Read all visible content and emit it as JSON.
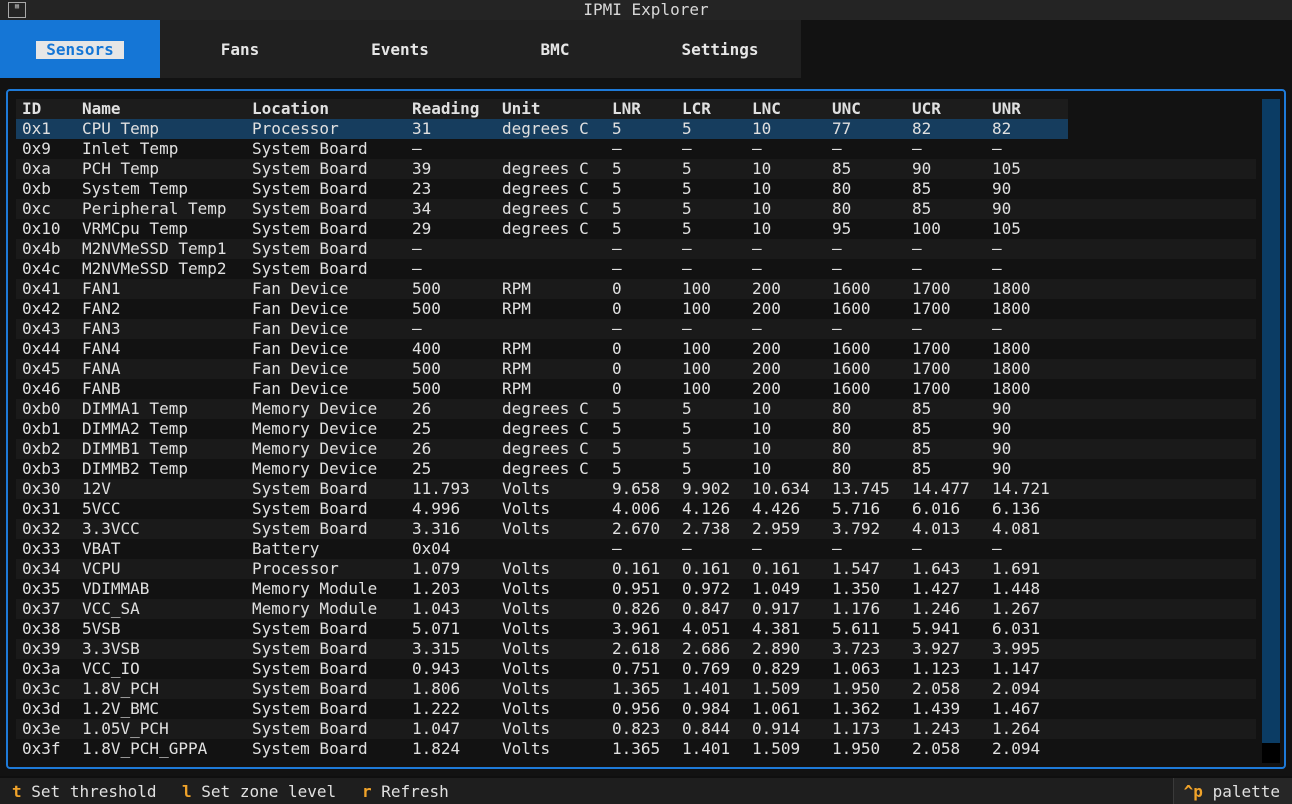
{
  "window": {
    "title": "IPMI Explorer",
    "corner_icon": "app-icon"
  },
  "tabs": [
    {
      "label": "Sensors",
      "active": true
    },
    {
      "label": "Fans",
      "active": false
    },
    {
      "label": "Events",
      "active": false
    },
    {
      "label": "BMC",
      "active": false
    },
    {
      "label": "Settings",
      "active": false
    }
  ],
  "table": {
    "columns": [
      "ID",
      "Name",
      "Location",
      "Reading",
      "Unit",
      "LNR",
      "LCR",
      "LNC",
      "UNC",
      "UCR",
      "UNR"
    ],
    "rows": [
      [
        "0x1",
        "CPU Temp",
        "Processor",
        "31",
        "degrees C",
        "5",
        "5",
        "10",
        "77",
        "82",
        "82"
      ],
      [
        "0x9",
        "Inlet Temp",
        "System Board",
        "–",
        "",
        "–",
        "–",
        "–",
        "–",
        "–",
        "–"
      ],
      [
        "0xa",
        "PCH Temp",
        "System Board",
        "39",
        "degrees C",
        "5",
        "5",
        "10",
        "85",
        "90",
        "105"
      ],
      [
        "0xb",
        "System Temp",
        "System Board",
        "23",
        "degrees C",
        "5",
        "5",
        "10",
        "80",
        "85",
        "90"
      ],
      [
        "0xc",
        "Peripheral Temp",
        "System Board",
        "34",
        "degrees C",
        "5",
        "5",
        "10",
        "80",
        "85",
        "90"
      ],
      [
        "0x10",
        "VRMCpu Temp",
        "System Board",
        "29",
        "degrees C",
        "5",
        "5",
        "10",
        "95",
        "100",
        "105"
      ],
      [
        "0x4b",
        "M2NVMeSSD Temp1",
        "System Board",
        "–",
        "",
        "–",
        "–",
        "–",
        "–",
        "–",
        "–"
      ],
      [
        "0x4c",
        "M2NVMeSSD Temp2",
        "System Board",
        "–",
        "",
        "–",
        "–",
        "–",
        "–",
        "–",
        "–"
      ],
      [
        "0x41",
        "FAN1",
        "Fan Device",
        "500",
        "RPM",
        "0",
        "100",
        "200",
        "1600",
        "1700",
        "1800"
      ],
      [
        "0x42",
        "FAN2",
        "Fan Device",
        "500",
        "RPM",
        "0",
        "100",
        "200",
        "1600",
        "1700",
        "1800"
      ],
      [
        "0x43",
        "FAN3",
        "Fan Device",
        "–",
        "",
        "–",
        "–",
        "–",
        "–",
        "–",
        "–"
      ],
      [
        "0x44",
        "FAN4",
        "Fan Device",
        "400",
        "RPM",
        "0",
        "100",
        "200",
        "1600",
        "1700",
        "1800"
      ],
      [
        "0x45",
        "FANA",
        "Fan Device",
        "500",
        "RPM",
        "0",
        "100",
        "200",
        "1600",
        "1700",
        "1800"
      ],
      [
        "0x46",
        "FANB",
        "Fan Device",
        "500",
        "RPM",
        "0",
        "100",
        "200",
        "1600",
        "1700",
        "1800"
      ],
      [
        "0xb0",
        "DIMMA1 Temp",
        "Memory Device",
        "26",
        "degrees C",
        "5",
        "5",
        "10",
        "80",
        "85",
        "90"
      ],
      [
        "0xb1",
        "DIMMA2 Temp",
        "Memory Device",
        "25",
        "degrees C",
        "5",
        "5",
        "10",
        "80",
        "85",
        "90"
      ],
      [
        "0xb2",
        "DIMMB1 Temp",
        "Memory Device",
        "26",
        "degrees C",
        "5",
        "5",
        "10",
        "80",
        "85",
        "90"
      ],
      [
        "0xb3",
        "DIMMB2 Temp",
        "Memory Device",
        "25",
        "degrees C",
        "5",
        "5",
        "10",
        "80",
        "85",
        "90"
      ],
      [
        "0x30",
        "12V",
        "System Board",
        "11.793",
        "Volts",
        "9.658",
        "9.902",
        "10.634",
        "13.745",
        "14.477",
        "14.721"
      ],
      [
        "0x31",
        "5VCC",
        "System Board",
        "4.996",
        "Volts",
        "4.006",
        "4.126",
        "4.426",
        "5.716",
        "6.016",
        "6.136"
      ],
      [
        "0x32",
        "3.3VCC",
        "System Board",
        "3.316",
        "Volts",
        "2.670",
        "2.738",
        "2.959",
        "3.792",
        "4.013",
        "4.081"
      ],
      [
        "0x33",
        "VBAT",
        "Battery",
        "0x04",
        "",
        "–",
        "–",
        "–",
        "–",
        "–",
        "–"
      ],
      [
        "0x34",
        "VCPU",
        "Processor",
        "1.079",
        "Volts",
        "0.161",
        "0.161",
        "0.161",
        "1.547",
        "1.643",
        "1.691"
      ],
      [
        "0x35",
        "VDIMMAB",
        "Memory Module",
        "1.203",
        "Volts",
        "0.951",
        "0.972",
        "1.049",
        "1.350",
        "1.427",
        "1.448"
      ],
      [
        "0x37",
        "VCC_SA",
        "Memory Module",
        "1.043",
        "Volts",
        "0.826",
        "0.847",
        "0.917",
        "1.176",
        "1.246",
        "1.267"
      ],
      [
        "0x38",
        "5VSB",
        "System Board",
        "5.071",
        "Volts",
        "3.961",
        "4.051",
        "4.381",
        "5.611",
        "5.941",
        "6.031"
      ],
      [
        "0x39",
        "3.3VSB",
        "System Board",
        "3.315",
        "Volts",
        "2.618",
        "2.686",
        "2.890",
        "3.723",
        "3.927",
        "3.995"
      ],
      [
        "0x3a",
        "VCC_IO",
        "System Board",
        "0.943",
        "Volts",
        "0.751",
        "0.769",
        "0.829",
        "1.063",
        "1.123",
        "1.147"
      ],
      [
        "0x3c",
        "1.8V_PCH",
        "System Board",
        "1.806",
        "Volts",
        "1.365",
        "1.401",
        "1.509",
        "1.950",
        "2.058",
        "2.094"
      ],
      [
        "0x3d",
        "1.2V_BMC",
        "System Board",
        "1.222",
        "Volts",
        "0.956",
        "0.984",
        "1.061",
        "1.362",
        "1.439",
        "1.467"
      ],
      [
        "0x3e",
        "1.05V_PCH",
        "System Board",
        "1.047",
        "Volts",
        "0.823",
        "0.844",
        "0.914",
        "1.173",
        "1.243",
        "1.264"
      ],
      [
        "0x3f",
        "1.8V_PCH_GPPA",
        "System Board",
        "1.824",
        "Volts",
        "1.365",
        "1.401",
        "1.509",
        "1.950",
        "2.058",
        "2.094"
      ]
    ]
  },
  "footer": {
    "bindings": [
      {
        "key": "t",
        "label": "Set threshold"
      },
      {
        "key": "l",
        "label": "Set zone level"
      },
      {
        "key": "r",
        "label": "Refresh"
      }
    ],
    "palette": {
      "key": "^p",
      "label": "palette"
    }
  },
  "colors": {
    "accent": "#1576d6",
    "selected_row": "#163d5e",
    "key_hint": "#f0a32a"
  }
}
